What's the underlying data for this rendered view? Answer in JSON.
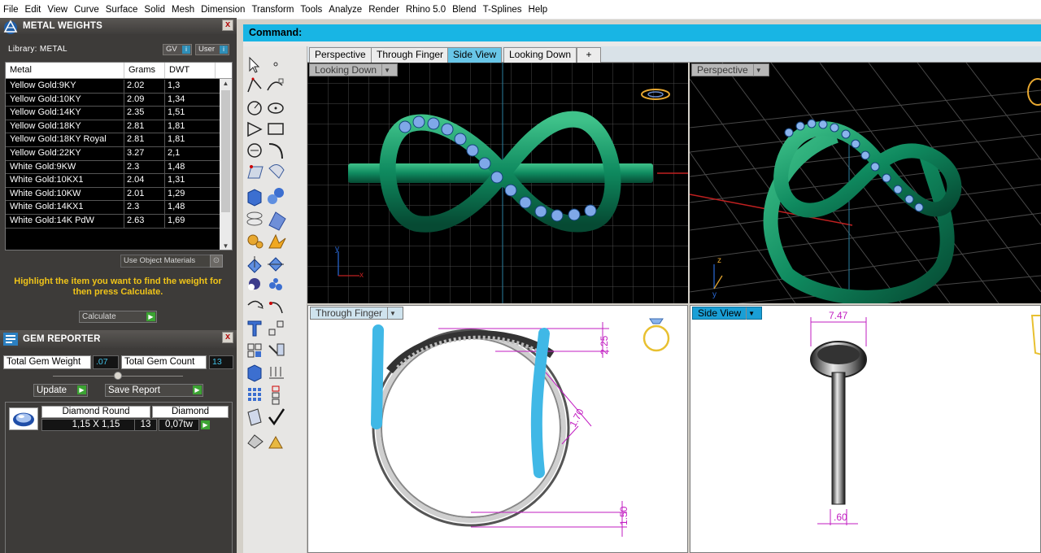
{
  "menubar": {
    "items": [
      "File",
      "Edit",
      "View",
      "Curve",
      "Surface",
      "Solid",
      "Mesh",
      "Dimension",
      "Transform",
      "Tools",
      "Analyze",
      "Render",
      "Rhino 5.0",
      "Blend",
      "T-Splines",
      "Help"
    ]
  },
  "metal_panel": {
    "title": "METAL WEIGHTS",
    "close": "x",
    "library_label": "Library: METAL",
    "gv_label": "GV",
    "user_label": "User",
    "info_icon": "i",
    "columns": [
      "Metal",
      "Grams",
      "DWT"
    ],
    "rows": [
      [
        "Yellow Gold:9KY",
        "2.02",
        "1,3"
      ],
      [
        "Yellow Gold:10KY",
        "2.09",
        "1,34"
      ],
      [
        "Yellow Gold:14KY",
        "2.35",
        "1,51"
      ],
      [
        "Yellow Gold:18KY",
        "2.81",
        "1,81"
      ],
      [
        "Yellow Gold:18KY Royal",
        "2.81",
        "1,81"
      ],
      [
        "Yellow Gold:22KY",
        "3.27",
        "2,1"
      ],
      [
        "White Gold:9KW",
        "2.3",
        "1,48"
      ],
      [
        "White Gold:10KX1",
        "2.04",
        "1,31"
      ],
      [
        "White Gold:10KW",
        "2.01",
        "1,29"
      ],
      [
        "White Gold:14KX1",
        "2.3",
        "1,48"
      ],
      [
        "White Gold:14K PdW",
        "2.63",
        "1,69"
      ]
    ],
    "use_object_materials": "Use Object Materials",
    "hint": "Highlight the item you want to find the weight for then press Calculate.",
    "calculate": "Calculate"
  },
  "gem_panel": {
    "title": "GEM REPORTER",
    "close": "x",
    "total_weight_label": "Total Gem Weight",
    "total_weight_value": ".07",
    "total_count_label": "Total Gem Count",
    "total_count_value": "13",
    "update": "Update",
    "save_report": "Save Report",
    "gem": {
      "shape": "Diamond Round",
      "size": "1,15 X 1,15",
      "material": "Diamond",
      "count": "13",
      "weight": "0,07tw"
    }
  },
  "command": {
    "label": "Command:"
  },
  "tabs": {
    "items": [
      "Perspective",
      "Through Finger",
      "Side View",
      "Looking Down"
    ],
    "active": "Side View",
    "add": "+"
  },
  "viewports": {
    "top_left": "Looking Down",
    "top_right": "Perspective",
    "bottom_left": "Through Finger",
    "bottom_right": "Side View"
  },
  "dimensions": {
    "top_height": "2.25",
    "diagonal": "1.70",
    "bottom_height": "1.50",
    "side_width": "7.47",
    "side_bottom": ".60"
  },
  "axis_labels": {
    "x": "x",
    "y": "y",
    "z": "z"
  },
  "colors": {
    "command_bar": "#18b5e4",
    "active_tab": "#68c6e8",
    "ring_green": "#0f8a5f",
    "gem_blue": "#7fa8e8",
    "dimension_magenta": "#c21ec2",
    "highlight_cyan": "#40b8e6",
    "hint_yellow": "#f0c419"
  }
}
